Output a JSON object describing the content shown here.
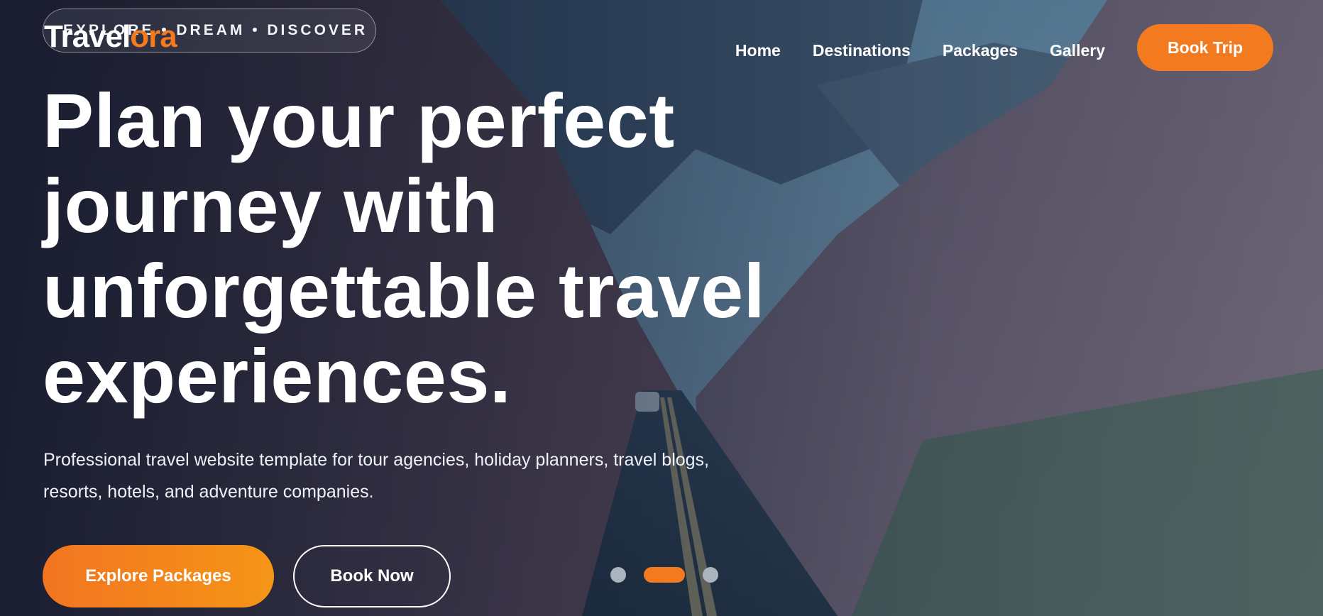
{
  "brand": {
    "name_main": "Travel",
    "name_accent": "ora"
  },
  "tagline": "EXPLORE • DREAM • DISCOVER",
  "nav": {
    "items": [
      "Home",
      "Destinations",
      "Packages",
      "Gallery"
    ],
    "cta": "Book Trip"
  },
  "hero": {
    "headline": "Plan your perfect journey with unforgettable travel experiences.",
    "description": "Professional travel website template for tour agencies, holiday planners, travel blogs, resorts, hotels, and adventure companies.",
    "primary_button": "Explore Packages",
    "secondary_button": "Book Now"
  },
  "slider": {
    "count": 3,
    "active_index": 1
  },
  "colors": {
    "accent": "#f47a20",
    "overlay": "#0a162c"
  }
}
